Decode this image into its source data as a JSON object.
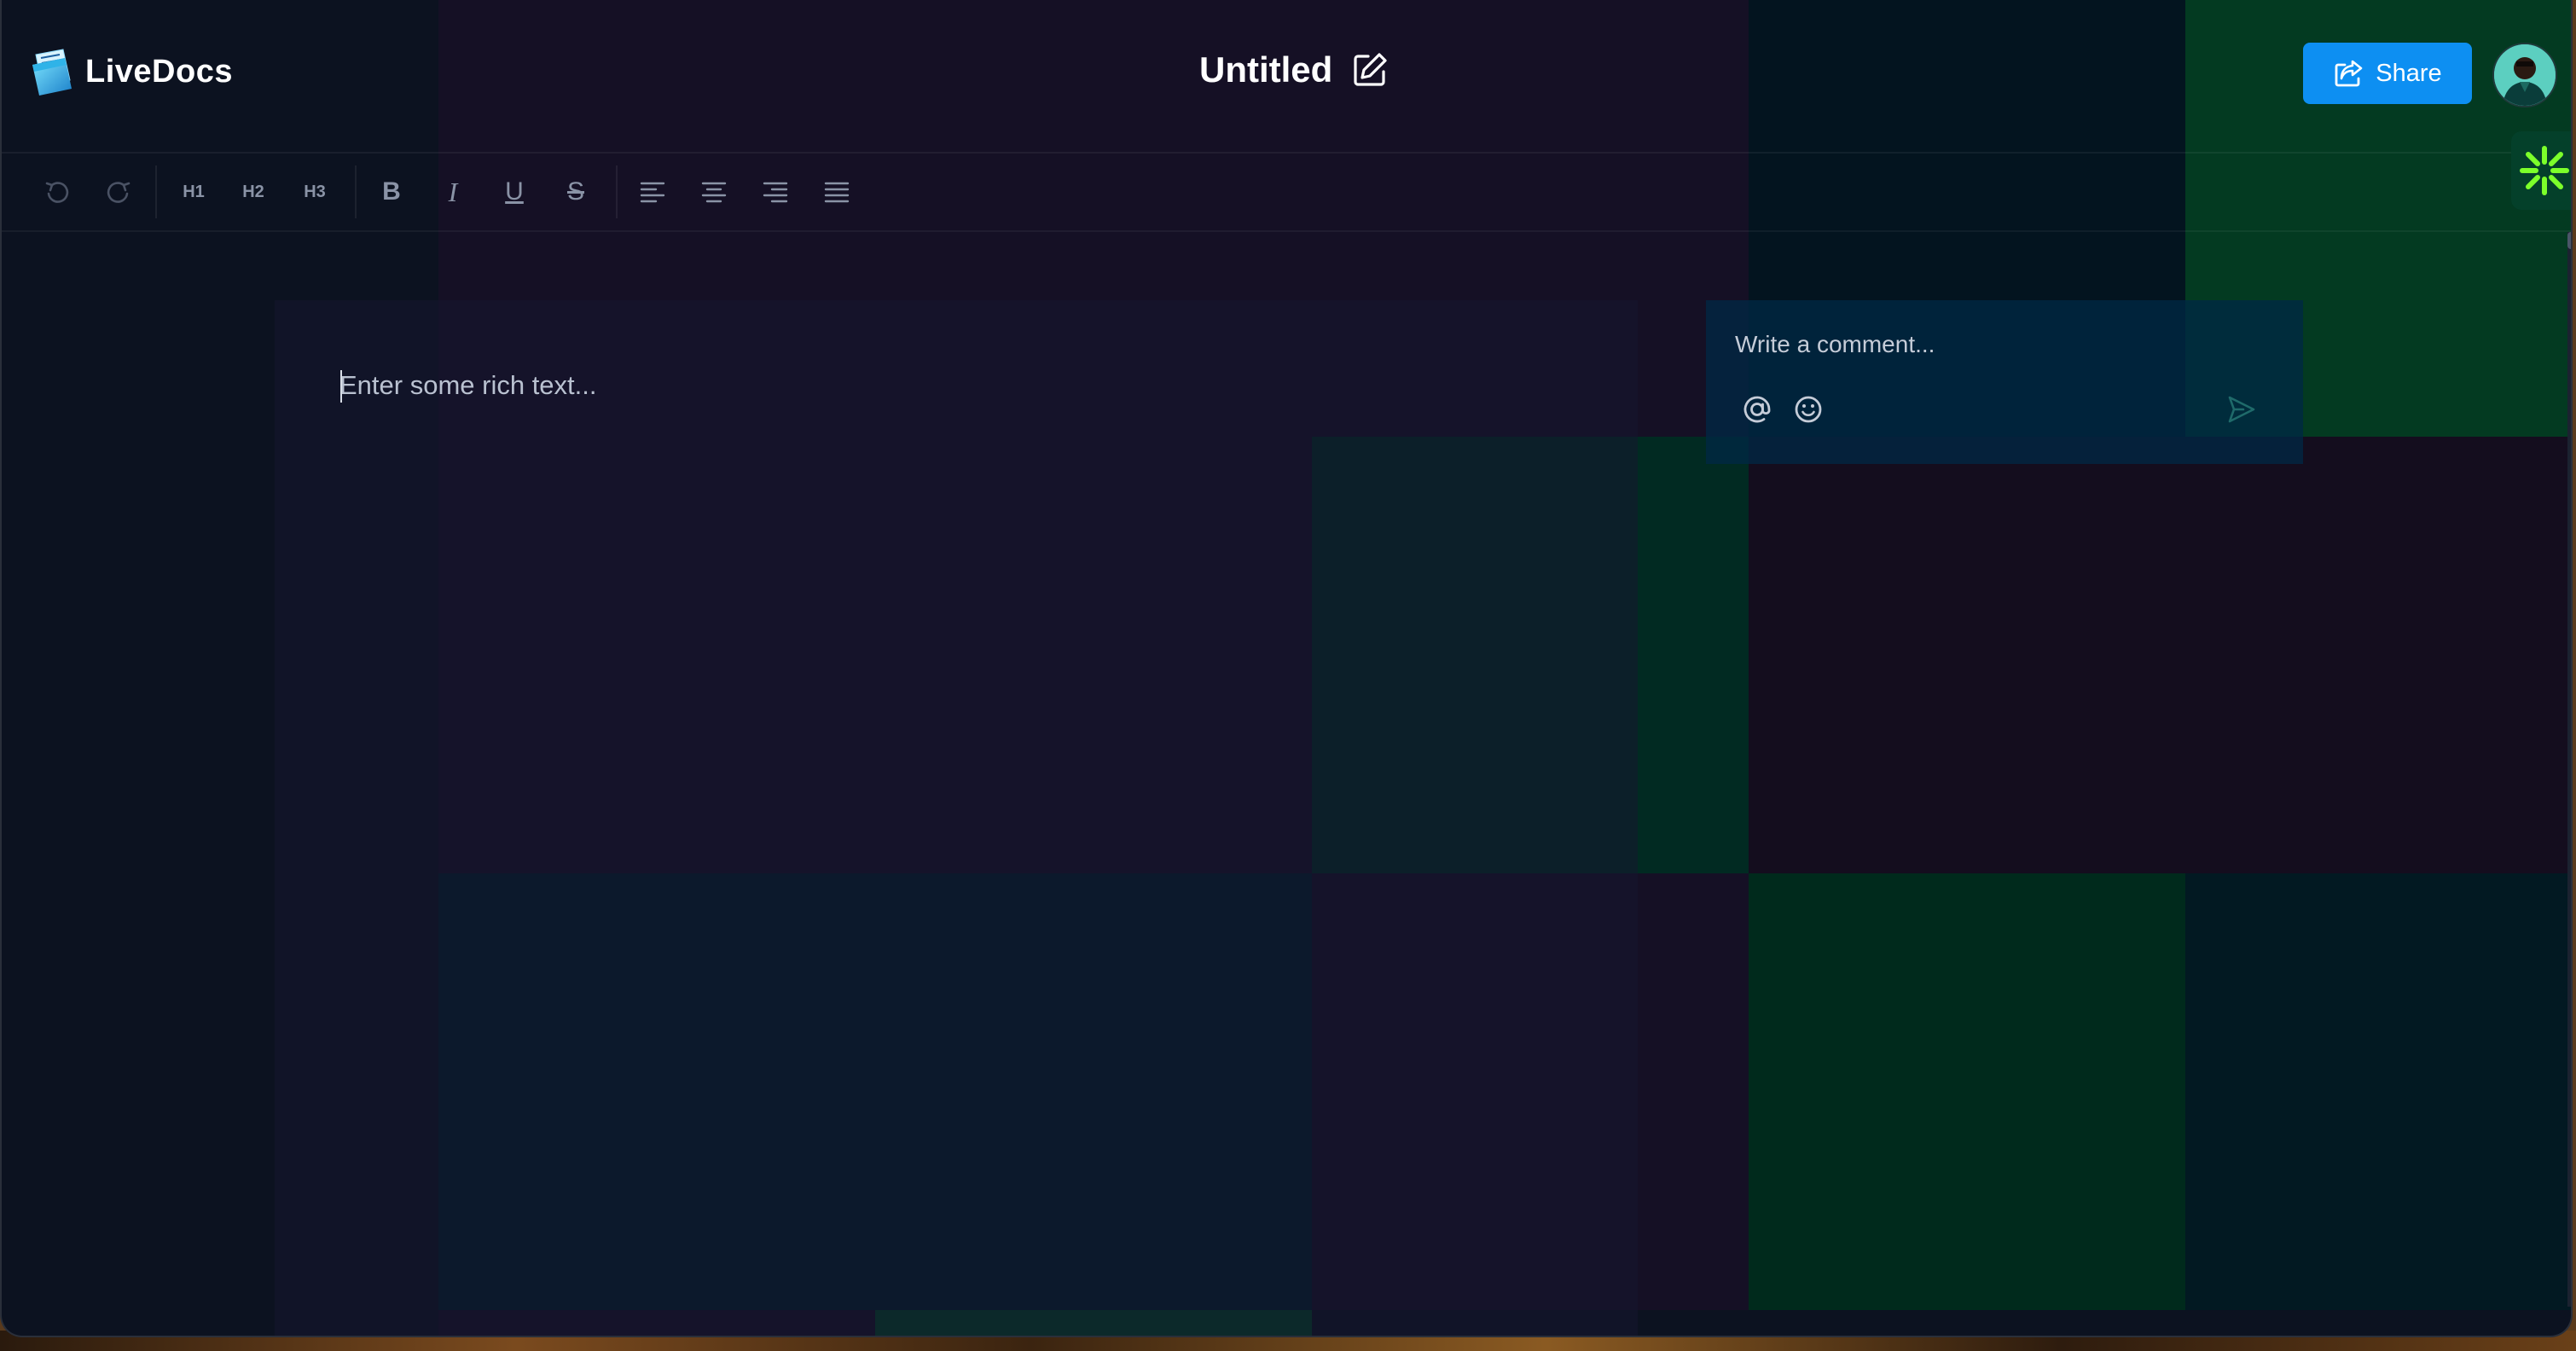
{
  "app": {
    "name": "LiveDocs",
    "logo_icon": "folder-doc-icon"
  },
  "document": {
    "title": "Untitled",
    "edit_icon": "edit-icon"
  },
  "header": {
    "share_label": "Share",
    "share_icon": "share-icon",
    "avatar_icon": "user-avatar"
  },
  "assistant": {
    "icon": "asterisk-spark-icon",
    "color": "#7cff2a"
  },
  "toolbar": {
    "undo_icon": "undo-icon",
    "redo_icon": "redo-icon",
    "h1_label": "H1",
    "h2_label": "H2",
    "h3_label": "H3",
    "bold_label": "B",
    "italic_label": "I",
    "underline_label": "U",
    "strike_label": "S",
    "align_left_icon": "align-left-icon",
    "align_center_icon": "align-center-icon",
    "align_right_icon": "align-right-icon",
    "align_justify_icon": "align-justify-icon"
  },
  "editor": {
    "placeholder": "Enter some rich text..."
  },
  "comment": {
    "placeholder": "Write a comment...",
    "mention_icon": "at-icon",
    "emoji_icon": "smiley-icon",
    "send_icon": "send-icon"
  },
  "colors": {
    "accent": "#0d8ff2",
    "background": "#0c1220",
    "text": "#ffffff"
  }
}
